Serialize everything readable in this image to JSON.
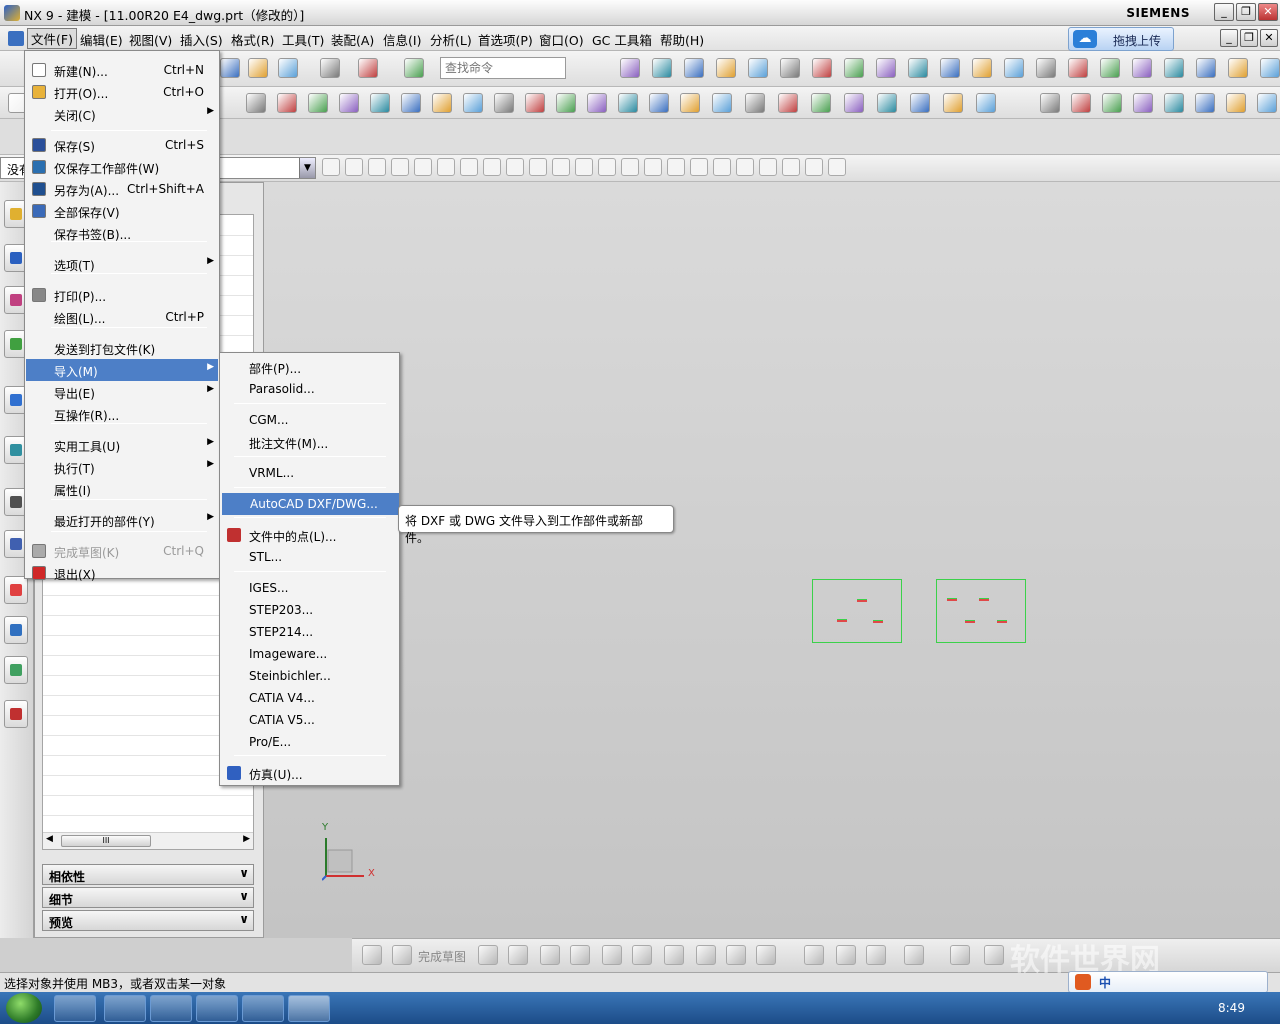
{
  "window": {
    "title": "NX 9 - 建模 - [11.00R20 E4_dwg.prt（修改的）]",
    "brand": "SIEMENS",
    "controls": {
      "minimize": "_",
      "restore": "❐",
      "close": "✕"
    }
  },
  "menubar": {
    "items": [
      "文件(F)",
      "编辑(E)",
      "视图(V)",
      "插入(S)",
      "格式(R)",
      "工具(T)",
      "装配(A)",
      "信息(I)",
      "分析(L)",
      "首选项(P)",
      "窗口(O)",
      "GC 工具箱",
      "帮助(H)"
    ],
    "upload_button": "拖拽上传"
  },
  "toolbar": {
    "command_search_placeholder": "查找命令"
  },
  "selection_bar": {
    "filter_value": "没有"
  },
  "file_menu": {
    "items": [
      {
        "label": "新建(N)...",
        "shortcut": "Ctrl+N",
        "icon": "new-file-icon"
      },
      {
        "label": "打开(O)...",
        "shortcut": "Ctrl+O",
        "icon": "open-folder-icon"
      },
      {
        "label": "关闭(C)",
        "shortcut": "",
        "icon": ""
      },
      {
        "label": "保存(S)",
        "shortcut": "Ctrl+S",
        "icon": "save-icon"
      },
      {
        "label": "仅保存工作部件(W)",
        "shortcut": "",
        "icon": "save-work-part-icon"
      },
      {
        "label": "另存为(A)...",
        "shortcut": "Ctrl+Shift+A",
        "icon": "save-as-icon"
      },
      {
        "label": "全部保存(V)",
        "shortcut": "",
        "icon": "save-all-icon"
      },
      {
        "label": "保存书签(B)...",
        "shortcut": "",
        "icon": ""
      },
      {
        "label": "选项(T)",
        "shortcut": "",
        "icon": ""
      },
      {
        "label": "打印(P)...",
        "shortcut": "",
        "icon": "print-icon"
      },
      {
        "label": "绘图(L)...",
        "shortcut": "Ctrl+P",
        "icon": ""
      },
      {
        "label": "发送到打包文件(K)",
        "shortcut": "",
        "icon": ""
      },
      {
        "label": "导入(M)",
        "shortcut": "",
        "icon": ""
      },
      {
        "label": "导出(E)",
        "shortcut": "",
        "icon": ""
      },
      {
        "label": "互操作(R)...",
        "shortcut": "",
        "icon": ""
      },
      {
        "label": "实用工具(U)",
        "shortcut": "",
        "icon": ""
      },
      {
        "label": "执行(T)",
        "shortcut": "",
        "icon": ""
      },
      {
        "label": "属性(I)",
        "shortcut": "",
        "icon": ""
      },
      {
        "label": "最近打开的部件(Y)",
        "shortcut": "",
        "icon": ""
      },
      {
        "label": "完成草图(K)",
        "shortcut": "Ctrl+Q",
        "icon": "finish-sketch-icon"
      },
      {
        "label": "退出(X)",
        "shortcut": "",
        "icon": "exit-icon"
      }
    ]
  },
  "import_menu": {
    "items": [
      "部件(P)...",
      "Parasolid...",
      "CGM...",
      "批注文件(M)...",
      "VRML...",
      "AutoCAD DXF/DWG...",
      "文件中的点(L)...",
      "STL...",
      "IGES...",
      "STEP203...",
      "STEP214...",
      "Imageware...",
      "Steinbichler...",
      "CATIA V4...",
      "CATIA V5...",
      "Pro/E...",
      "仿真(U)..."
    ]
  },
  "tooltip": "将 DXF 或 DWG 文件导入到工作部件或新部件。",
  "navigator": {
    "sections": [
      "相依性",
      "细节",
      "预览"
    ],
    "scroll_thumb": "III"
  },
  "triad": {
    "y": "Y",
    "x": "X"
  },
  "sketch_toolbar": {
    "finish_label": "完成草图"
  },
  "status": {
    "message": "选择对象并使用 MB3，或者双击某一对象"
  },
  "taskbar": {
    "clock": "8:49"
  },
  "watermark": "软件世界网",
  "ime": {
    "mode": "中"
  },
  "colors": {
    "menu_highlight": "#4d7fc7",
    "geometry_green": "#3bd14a",
    "taskbar": "#2a5fa0"
  }
}
